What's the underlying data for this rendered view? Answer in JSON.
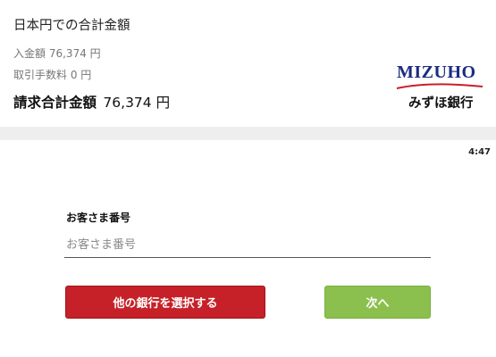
{
  "summary": {
    "title": "日本円での合計金額",
    "deposit_label": "入金額",
    "deposit_amount": "76,374 円",
    "fee_label": "取引手数料",
    "fee_amount": "0 円",
    "total_label": "請求合計金額",
    "total_amount": "76,374 円"
  },
  "bank": {
    "wordmark": "MIZUHO",
    "name": "みずほ銀行",
    "brand_color": "#1b2c80",
    "swoosh_color": "#c62128"
  },
  "status": {
    "time": "4:47"
  },
  "form": {
    "customer_number_label": "お客さま番号",
    "customer_number_placeholder": "お客さま番号",
    "customer_number_value": ""
  },
  "buttons": {
    "other_bank_label": "他の銀行を選択する",
    "other_bank_color": "#c62128",
    "next_label": "次へ",
    "next_color": "#8cc04e"
  }
}
